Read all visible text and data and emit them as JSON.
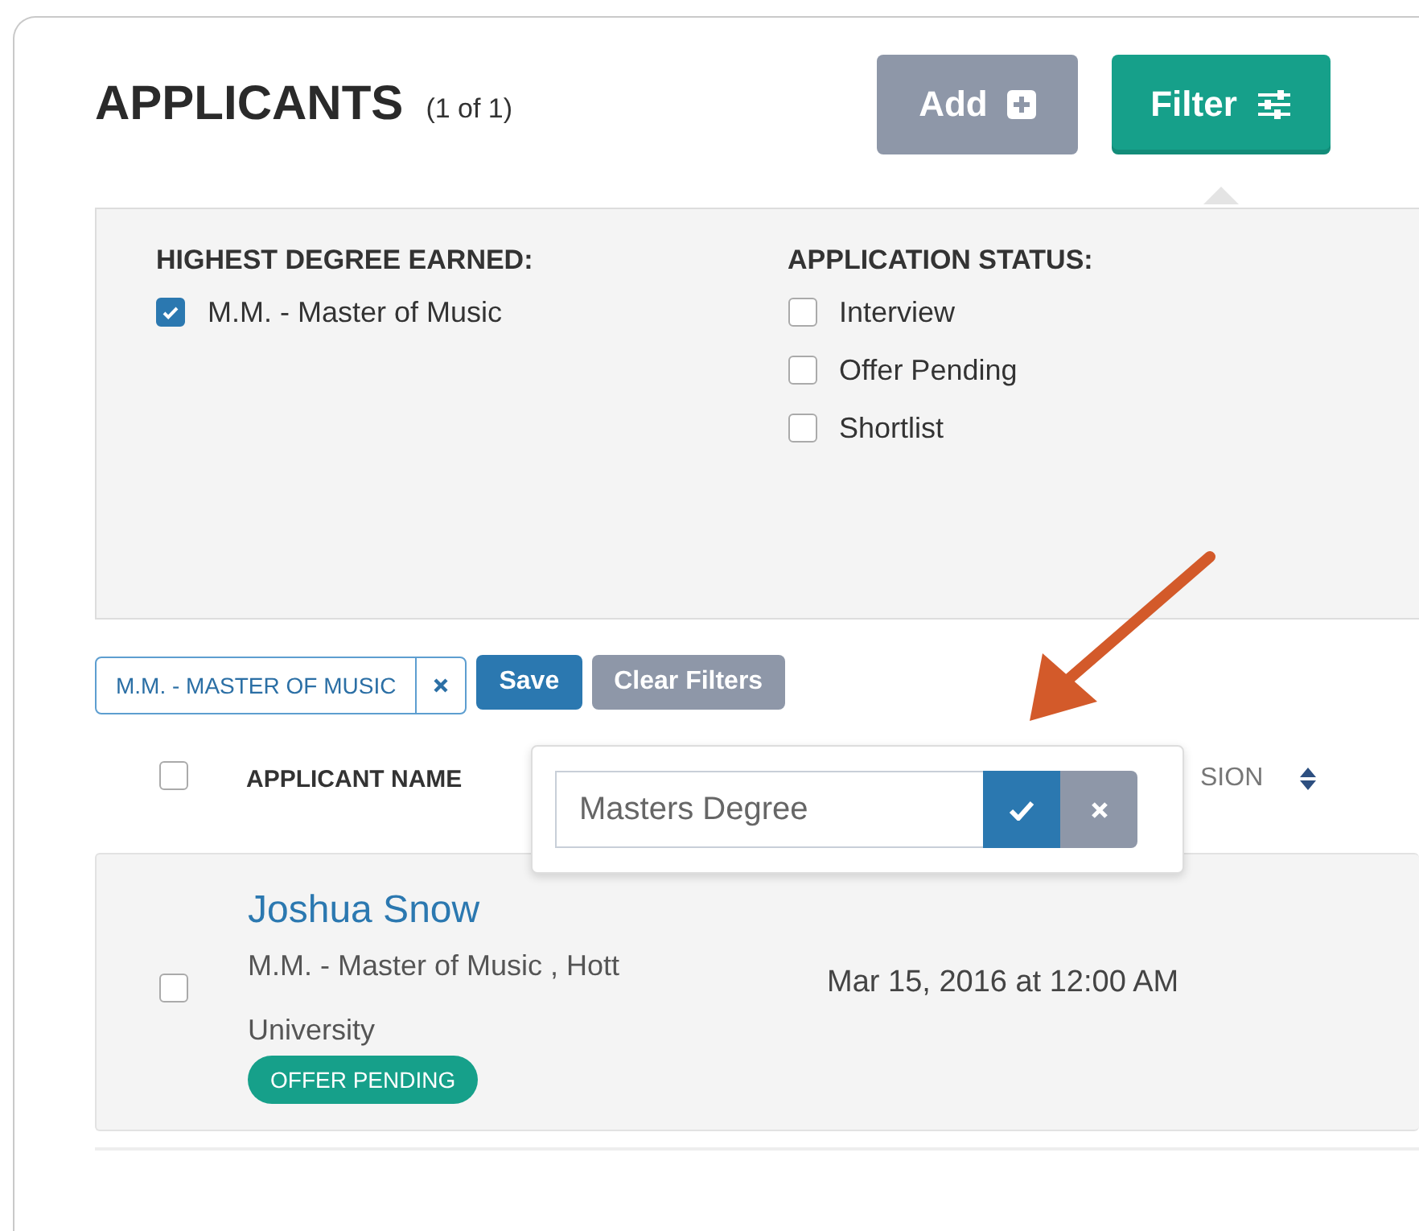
{
  "header": {
    "title": "APPLICANTS",
    "count": "(1 of 1)",
    "buttons": [
      {
        "label": "Add",
        "kind": "add",
        "selected": false
      },
      {
        "label": "Filter",
        "kind": "filter",
        "selected": true
      }
    ]
  },
  "filters": [
    {
      "heading": "HIGHEST DEGREE EARNED:",
      "options": [
        {
          "label": "M.M. - Master of Music",
          "checked": true
        }
      ]
    },
    {
      "heading": "APPLICATION STATUS:",
      "options": [
        {
          "label": "Interview",
          "checked": false
        },
        {
          "label": "Offer Pending",
          "checked": false
        },
        {
          "label": "Shortlist",
          "checked": false
        }
      ]
    }
  ],
  "active_filters": {
    "tags": [
      {
        "label": "M.M. - MASTER OF MUSIC"
      }
    ],
    "buttons": [
      {
        "label": "Save",
        "kind": "primary"
      },
      {
        "label": "Clear Filters",
        "kind": "secondary"
      }
    ]
  },
  "rename_popover": {
    "value": "Masters Degree"
  },
  "table": {
    "select_all_checked": false,
    "columns": [
      {
        "label": "APPLICANT NAME",
        "sortable": false
      },
      {
        "label": "SION",
        "sortable": true
      }
    ],
    "rows": [
      {
        "checked": false,
        "name": "Joshua Snow",
        "detail": "M.M. - Master of Music , Hott University",
        "status": "OFFER PENDING",
        "date": "Mar 15, 2016 at 12:00 AM"
      }
    ]
  }
}
